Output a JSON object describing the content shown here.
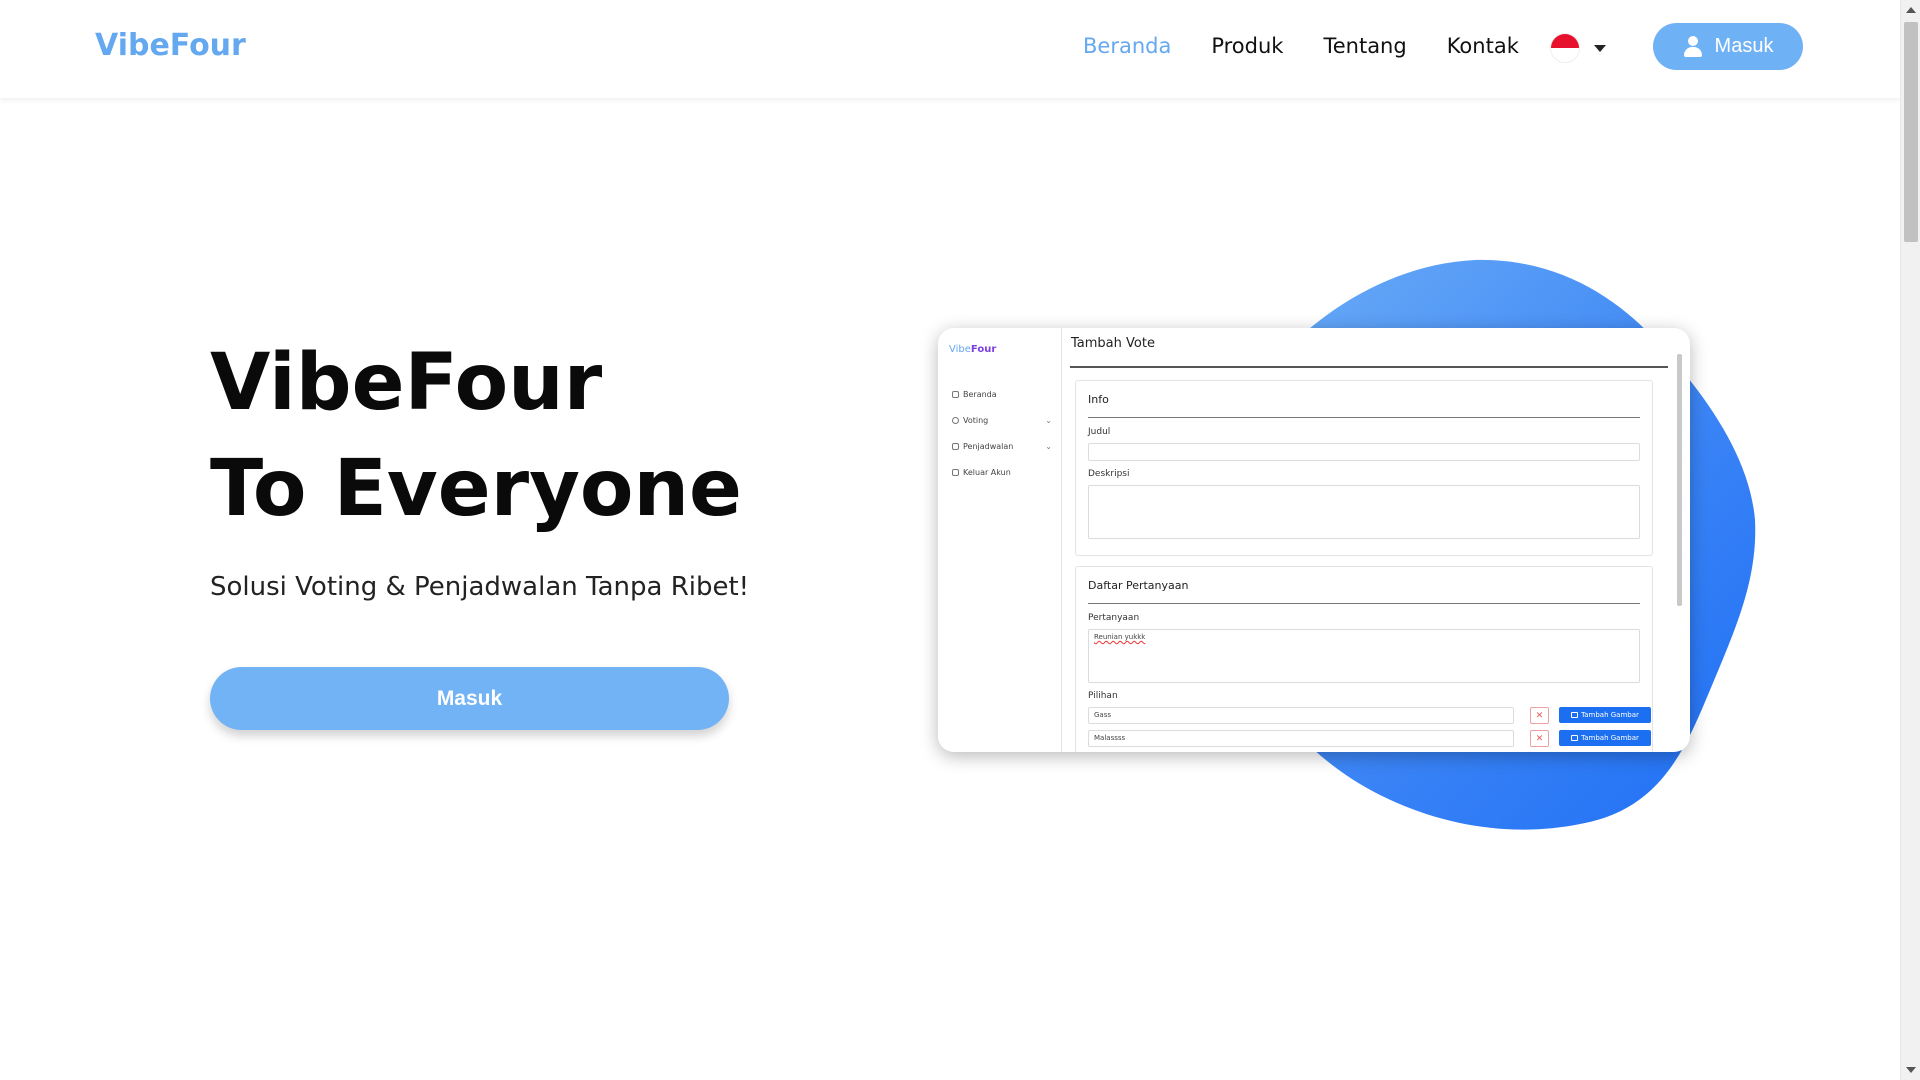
{
  "navbar": {
    "brand": "VibeFour",
    "links": [
      "Beranda",
      "Produk",
      "Tentang",
      "Kontak"
    ],
    "active_link": "Beranda",
    "language_flag": "indonesia-flag",
    "login_label": "Masuk"
  },
  "hero": {
    "title_line1": "VibeFour",
    "title_line2": "To Everyone",
    "subtitle": "Solusi Voting & Penjadwalan Tanpa Ribet!",
    "cta_label": "Masuk"
  },
  "mockup": {
    "brand_vibe": "Vibe",
    "brand_four": "Four",
    "sidebar": [
      "Beranda",
      "Voting",
      "Penjadwalan",
      "Keluar Akun"
    ],
    "page_title": "Tambah Vote",
    "info_card": {
      "title": "Info",
      "judul_label": "Judul",
      "deskripsi_label": "Deskripsi"
    },
    "questions_card": {
      "title": "Daftar Pertanyaan",
      "pertanyaan_label": "Pertanyaan",
      "pertanyaan_value": "Reunian yukkk",
      "pilihan_label": "Pilihan",
      "options": [
        "Gass",
        "Malassss"
      ],
      "remove_symbol": "✕",
      "add_image_label": "Tambah Gambar"
    }
  },
  "colors": {
    "brand_blue": "#64a8f0",
    "button_blue": "#6fb1f5",
    "blob_blue": "#2f7df5",
    "accent_purple": "#7b3fe4"
  }
}
